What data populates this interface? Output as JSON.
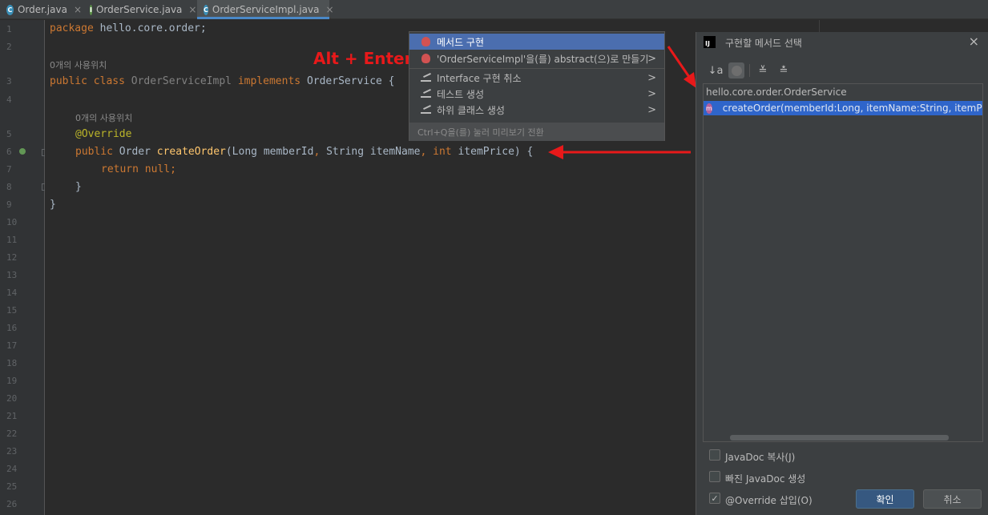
{
  "tabs": [
    {
      "label": "Order.java",
      "icon": "class-icon",
      "letter": "C"
    },
    {
      "label": "OrderService.java",
      "icon": "interface-icon",
      "letter": "I"
    },
    {
      "label": "OrderServiceImpl.java",
      "icon": "class-icon",
      "letter": "C",
      "active": true
    }
  ],
  "tab_close": "×",
  "editor": {
    "line_numbers": [
      "1",
      "2",
      "3",
      "4",
      "5",
      "6",
      "7",
      "8",
      "9",
      "10",
      "11",
      "12",
      "13",
      "14",
      "15",
      "16",
      "17",
      "18",
      "19",
      "20",
      "21",
      "22",
      "23",
      "24",
      "25",
      "26"
    ],
    "usage_hint": "0개의 사용위치",
    "code": {
      "l1_kw": "package",
      "l1_rest": " hello.core.order;",
      "l3_kw1": "public",
      "l3_kw2": "class",
      "l3_cls": "OrderServiceImpl",
      "l3_kw3": "implements",
      "l3_iface": "OrderService",
      "l3_brace": " {",
      "l5_ann": "@Override",
      "l6_kw": "public",
      "l6_type": " Order ",
      "l6_fn": "createOrder",
      "l6_p1": "(Long memberId",
      "l6_c1": ",",
      "l6_p2": " String itemName",
      "l6_c2": ",",
      "l6_kwint": " int",
      "l6_p3": " itemPrice) {",
      "l7_kw": "return",
      "l7_null": " null",
      "l7_semi": ";",
      "l8": "}",
      "l9": "}"
    }
  },
  "annotation_label": "Alt + Enter",
  "arrow_color": "#e8191a",
  "popup": {
    "items": [
      {
        "label": "메서드 구현",
        "icon": "bulb-icon",
        "selected": true,
        "submenu": false
      },
      {
        "label": "'OrderServiceImpl'을(를) abstract(으)로 만들기",
        "icon": "bulb-icon",
        "submenu": true
      },
      {
        "label": "Interface 구현 취소",
        "icon": "pencil-icon",
        "submenu": true
      },
      {
        "label": "테스트 생성",
        "icon": "pencil-icon",
        "submenu": true
      },
      {
        "label": "하위 클래스 생성",
        "icon": "pencil-icon",
        "submenu": true
      }
    ],
    "submenu_arrow": ">",
    "footer": "Ctrl+Q을(를) 눌러 미리보기 전환"
  },
  "dialog": {
    "title": "구현할 메서드 선택",
    "logo_text": "IJ",
    "close": "×",
    "toolbar": {
      "sort_icon": "↓a",
      "expand_icon": "≚",
      "collapse_icon": "≛"
    },
    "tree_root": "hello.core.order.OrderService",
    "tree_method": "createOrder(memberId:Long, itemName:String, itemPrice:i",
    "method_icon_letter": "m",
    "checkboxes": [
      {
        "label": "JavaDoc 복사(J)",
        "checked": false
      },
      {
        "label": "빠진 JavaDoc 생성",
        "checked": false
      },
      {
        "label": "@Override 삽입(O)",
        "checked": true
      }
    ],
    "check_mark": "✓",
    "ok_label": "확인",
    "cancel_label": "취소"
  }
}
